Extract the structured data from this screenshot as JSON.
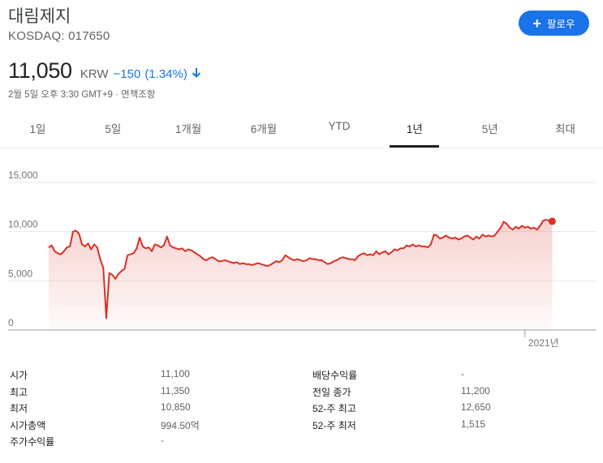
{
  "header": {
    "company_name": "대림제지",
    "ticker": "KOSDAQ: 017650",
    "follow_label": "팔로우"
  },
  "quote": {
    "price": "11,050",
    "currency": "KRW",
    "change": "−150",
    "change_pct": "(1.34%)",
    "direction": "down",
    "timestamp": "2월 5일 오후 3:30 GMT+9 · 면책조항"
  },
  "colors": {
    "accent": "#1a73e8",
    "down_line": "#d93025"
  },
  "tabs": [
    {
      "label": "1일",
      "active": false
    },
    {
      "label": "5일",
      "active": false
    },
    {
      "label": "1개월",
      "active": false
    },
    {
      "label": "6개월",
      "active": false
    },
    {
      "label": "YTD",
      "active": false
    },
    {
      "label": "1년",
      "active": true
    },
    {
      "label": "5년",
      "active": false
    },
    {
      "label": "최대",
      "active": false
    }
  ],
  "chart_data": {
    "type": "area",
    "ylim": [
      0,
      15000
    ],
    "ytick_labels": [
      "15,000",
      "10,000",
      "5,000",
      "0"
    ],
    "ytick_values": [
      15000,
      10000,
      5000,
      0
    ],
    "xtick_labels": [
      "2021년"
    ],
    "xtick_positions": [
      157
    ],
    "x_range": [
      0,
      179
    ],
    "series": [
      {
        "values": [
          8400,
          8600,
          8000,
          7800,
          7700,
          8000,
          8400,
          8500,
          10000,
          10100,
          9800,
          8700,
          8500,
          8800,
          8200,
          8700,
          8400,
          7200,
          6300,
          1200,
          5800,
          5600,
          5200,
          5700,
          6000,
          6200,
          7600,
          7700,
          7800,
          8300,
          9400,
          8500,
          8300,
          8400,
          8000,
          8700,
          8600,
          8400,
          8600,
          9500,
          8600,
          8400,
          8300,
          8200,
          8300,
          8000,
          8200,
          8100,
          7900,
          7700,
          7500,
          7200,
          7100,
          7300,
          7400,
          7200,
          7000,
          7000,
          7100,
          7000,
          6900,
          6800,
          6900,
          6700,
          6800,
          6700,
          6700,
          6600,
          6700,
          6800,
          6700,
          6600,
          6500,
          6600,
          6800,
          7000,
          6900,
          7100,
          7600,
          7400,
          7200,
          7100,
          7200,
          7100,
          7000,
          7100,
          7300,
          7200,
          7200,
          7100,
          7100,
          6900,
          6700,
          6800,
          7000,
          7100,
          7300,
          7400,
          7300,
          7200,
          7200,
          7100,
          7500,
          7700,
          7800,
          7600,
          7700,
          7600,
          8000,
          7700,
          7900,
          8000,
          7700,
          7900,
          8200,
          8100,
          8300,
          8300,
          8600,
          8500,
          8700,
          8500,
          8600,
          8500,
          8500,
          8400,
          8700,
          9700,
          9600,
          9300,
          9400,
          9600,
          9400,
          9300,
          9400,
          9200,
          9300,
          9500,
          9600,
          9400,
          9200,
          9500,
          9300,
          9700,
          9500,
          9600,
          9500,
          9600,
          10000,
          10400,
          11000,
          10800,
          10400,
          10200,
          10500,
          10300,
          10600,
          10400,
          10500,
          10300,
          10400,
          10200,
          10600,
          11100,
          11200,
          11100,
          11050
        ]
      }
    ]
  },
  "stats": {
    "left": [
      {
        "label": "시가",
        "value": "11,100"
      },
      {
        "label": "최고",
        "value": "11,350"
      },
      {
        "label": "최저",
        "value": "10,850"
      },
      {
        "label": "시가총액",
        "value": "994.50억"
      },
      {
        "label": "주가수익률",
        "value": "-"
      }
    ],
    "right": [
      {
        "label": "배당수익률",
        "value": "-"
      },
      {
        "label": "전일 종가",
        "value": "11,200"
      },
      {
        "label": "52-주 최고",
        "value": "12,650"
      },
      {
        "label": "52-주 최저",
        "value": "1,515"
      }
    ]
  },
  "icons": {
    "follow": "plus-icon",
    "direction": "arrow-down-icon"
  }
}
